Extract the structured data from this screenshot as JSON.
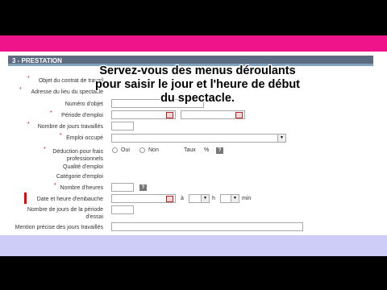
{
  "section": {
    "title": "3 - PRESTATION"
  },
  "fields": {
    "objet_contrat": "Objet du contrat de travail",
    "adresse": "Adresse du lieu du spectacle",
    "numero_objet": "Numéro d'objet",
    "periode_emploi": "Période d'emploi",
    "nb_jours": "Nombre de jours travaillés",
    "emploi_occupe": "Emploi occupé",
    "deduction": "Déduction pour frais professionnels",
    "qualite": "Qualité d'emploi",
    "categorie": "Catégorie d'emploi",
    "nb_heures": "Nombre d'heures",
    "date_heure": "Date et heure d'embauche",
    "nb_jours_essai": "Nombre de jours de la période d'essai",
    "mention": "Mention précise des jours travaillés"
  },
  "deduction_options": {
    "oui": "Oui",
    "non": "Non",
    "taux": "Taux",
    "percent": "%"
  },
  "time_labels": {
    "a": "à",
    "h": "h",
    "min": "min"
  },
  "help_icon": "?",
  "overlay": {
    "line1": "Servez-vous des menus déroulants",
    "line2": "pour saisir le jour et l'heure de début",
    "line3": "du spectacle."
  },
  "colors": {
    "banner_pink": "#f0148a",
    "header_bg": "#5c6b80",
    "footer_lavender": "#cdcdf7",
    "highlight_marker": "#e00000"
  }
}
